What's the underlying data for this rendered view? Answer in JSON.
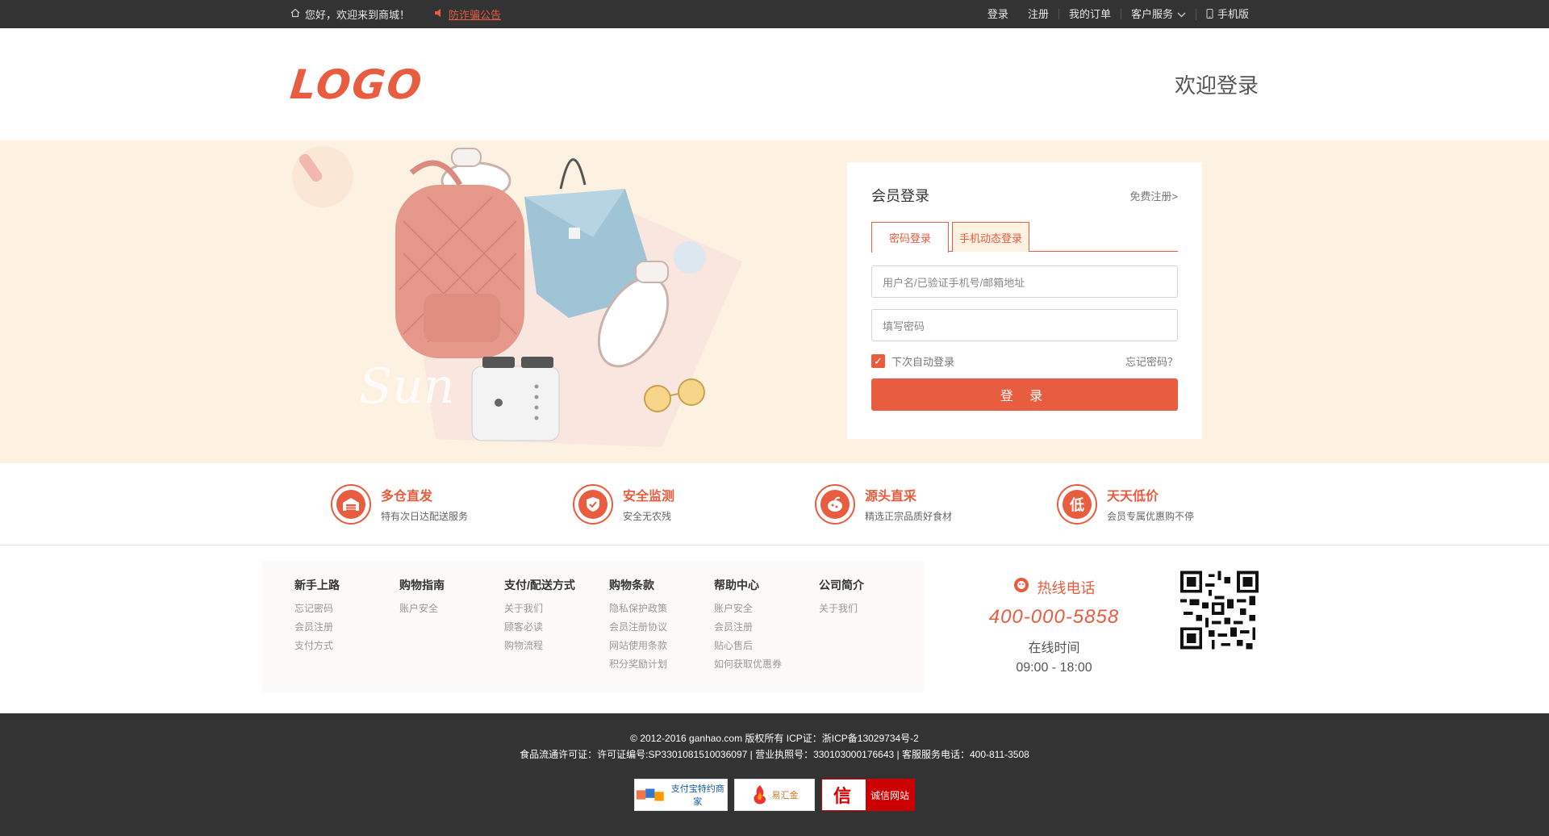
{
  "topbar": {
    "greeting": "您好，欢迎来到商城！",
    "notice": "防诈骗公告",
    "login": "登录",
    "register": "注册",
    "orders": "我的订单",
    "service": "客户服务",
    "mobile": "手机版"
  },
  "header": {
    "logo": "LOGO",
    "welcome": "欢迎登录"
  },
  "login": {
    "title": "会员登录",
    "register_link": "免费注册>",
    "tabs": [
      "密码登录",
      "手机动态登录"
    ],
    "active_tab": 0,
    "username_placeholder": "用户名/已验证手机号/邮箱地址",
    "password_placeholder": "填写密码",
    "remember_label": "下次自动登录",
    "remember_checked": true,
    "forgot": "忘记密码？",
    "submit": "登 录"
  },
  "features": [
    {
      "icon": "warehouse-icon",
      "title": "多仓直发",
      "sub": "特有次日达配送服务"
    },
    {
      "icon": "shield-check-icon",
      "title": "安全监测",
      "sub": "安全无农残"
    },
    {
      "icon": "food-icon",
      "title": "源头直采",
      "sub": "精选正宗品质好食材"
    },
    {
      "icon": "low-price-icon",
      "title": "天天低价",
      "sub": "会员专属优惠购不停",
      "glyph": "低"
    }
  ],
  "footer_cols": [
    {
      "title": "新手上路",
      "links": [
        "忘记密码",
        "会员注册",
        "支付方式"
      ]
    },
    {
      "title": "购物指南",
      "links": [
        "账户安全"
      ]
    },
    {
      "title": "支付/配送方式",
      "links": [
        "关于我们",
        "顾客必读",
        "购物流程"
      ]
    },
    {
      "title": "购物条款",
      "links": [
        "隐私保护政策",
        "会员注册协议",
        "网站使用条款",
        "积分奖励计划"
      ]
    },
    {
      "title": "帮助中心",
      "links": [
        "账户安全",
        "会员注册",
        "贴心售后",
        "如何获取优惠券"
      ]
    },
    {
      "title": "公司简介",
      "links": [
        "关于我们"
      ]
    }
  ],
  "hotline": {
    "title": "热线电话",
    "number": "400-000-5858",
    "hours_label": "在线时间",
    "hours": "09:00 - 18:00"
  },
  "bottom": {
    "copyright": "© 2012-2016 ganhao.com 版权所有 ICP证：浙ICP备13029734号-2",
    "license": "食品流通许可证：许可证编号:SP3301081510036097 | 营业执照号：330103000176643 | 客服服务电话：400-811-3508",
    "badges": [
      {
        "text": "支付宝特约商家"
      },
      {
        "text": "易汇金"
      },
      {
        "icon": "信",
        "text": "诚信网站"
      }
    ]
  },
  "colors": {
    "accent": "#e85c3f",
    "banner_bg": "#fdf1e1",
    "dark_bar": "#333333"
  }
}
